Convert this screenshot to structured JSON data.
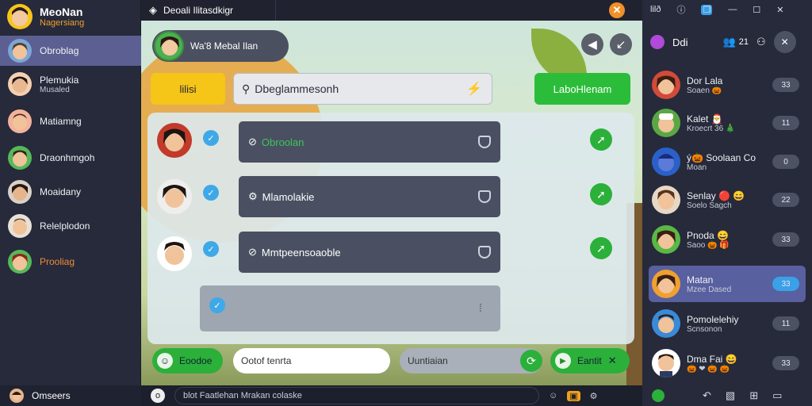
{
  "app": {
    "name": "MeoNan",
    "subtitle": "Nagersiang"
  },
  "left_sidebar": {
    "items": [
      {
        "name": "Obroblag",
        "sub": "",
        "active": true
      },
      {
        "name": "Plemukia",
        "sub": "Musaled",
        "active": false
      },
      {
        "name": "Matiamng",
        "sub": "",
        "active": false
      },
      {
        "name": "Draonhmgoh",
        "sub": "",
        "active": false
      },
      {
        "name": "Moaidany",
        "sub": "",
        "active": false
      },
      {
        "name": "Relelplodon",
        "sub": "",
        "active": false
      },
      {
        "name": "Prooliag",
        "sub": "",
        "active": false,
        "highlight": true
      }
    ],
    "footer": "Omseers"
  },
  "topbar": {
    "tab_title": "Deoali Ilitasdkigr"
  },
  "main": {
    "header_pill": "Wa'8 Mebal Ilan",
    "yellow_button": "lilisi",
    "search_value": "Dbeglammesonh",
    "green_button": "LaboHlenam",
    "rows": [
      {
        "label": "Obroolan",
        "label_color": "#3ec45a"
      },
      {
        "label": "Mlamolakie",
        "label_color": "#ffffff"
      },
      {
        "label": "Mmtpeensoaoble",
        "label_color": "#ffffff"
      }
    ],
    "bottom": {
      "left_pill": "Eoodoe",
      "white_pill": "Ootof tenrta",
      "grey_pill": "Uuntiaian",
      "right_pill": "Eantit"
    }
  },
  "composer": {
    "placeholder": "blot Faatlehan Mrakan colaske"
  },
  "right_sidebar": {
    "top_label": "lilð",
    "header_name": "Ddi",
    "header_count": "21",
    "items": [
      {
        "name": "Dor Lala",
        "sub": "Soaen 🎃",
        "count": "33",
        "active": false
      },
      {
        "name": "Kalet 🎅",
        "sub": "Kroecrt 36 🎄",
        "count": "11",
        "active": false
      },
      {
        "name": "ý🎃 Soolaan Co",
        "sub": "Moan",
        "count": "0",
        "active": false
      },
      {
        "name": "Senlay 🔴 😄",
        "sub": "Soelo Sagch",
        "count": "22",
        "active": false
      },
      {
        "name": "Pnoda 😄",
        "sub": "Saoo 🎃 🎁",
        "count": "33",
        "active": false
      },
      {
        "name": "Matan",
        "sub": "Mzee Dased",
        "count": "33",
        "active": true
      },
      {
        "name": "Pomolelehiy",
        "sub": "Scnsonon",
        "count": "11",
        "active": false
      },
      {
        "name": "Dma Fai 😄",
        "sub": "🎃 ❤ 🎃 🎃",
        "count": "33",
        "active": false
      }
    ]
  },
  "colors": {
    "accent": "#5b5f92",
    "green": "#2bbd3a",
    "yellow": "#f5c518",
    "orange": "#f0902a",
    "blue": "#3aa0e8"
  }
}
